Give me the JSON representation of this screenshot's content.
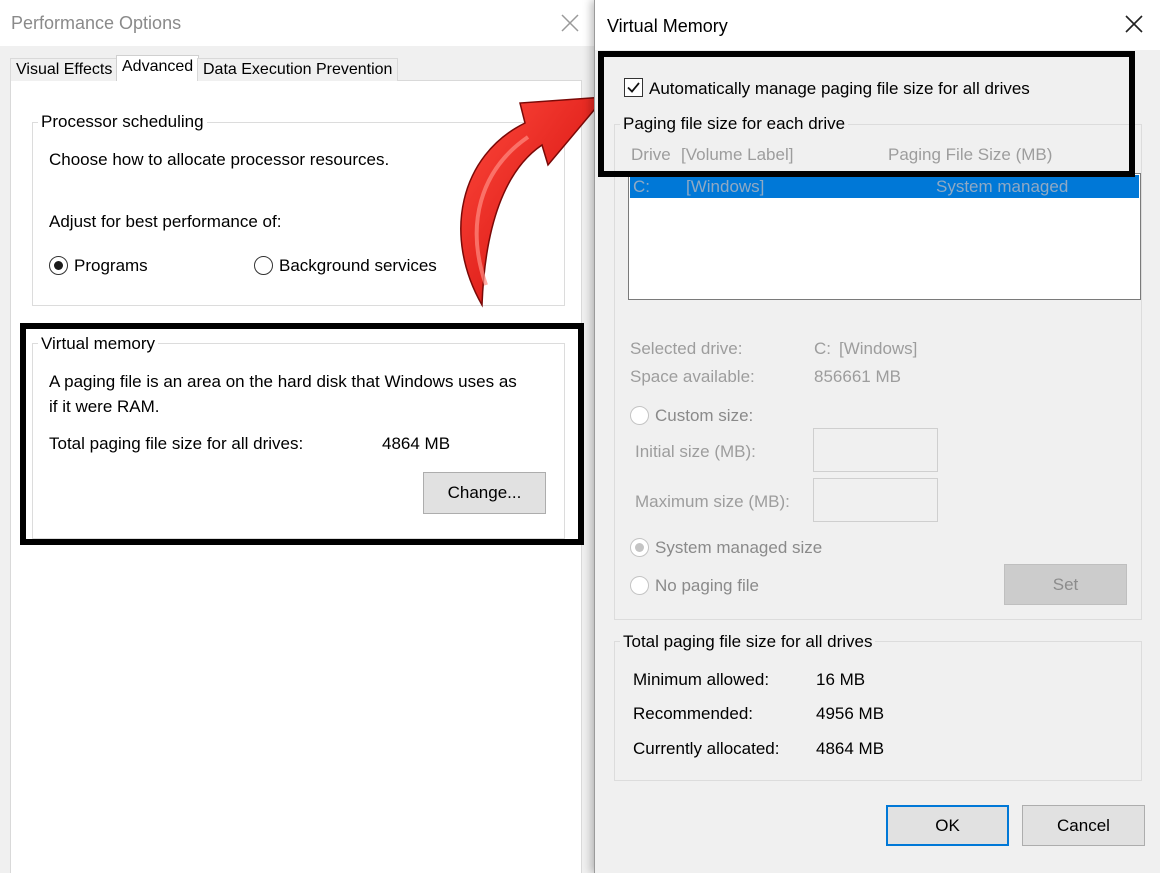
{
  "performance_options": {
    "title": "Performance Options",
    "tabs": [
      {
        "label": "Visual Effects",
        "active": false
      },
      {
        "label": "Advanced",
        "active": true
      },
      {
        "label": "Data Execution Prevention",
        "active": false
      }
    ],
    "processor_scheduling": {
      "group_label": "Processor scheduling",
      "description": "Choose how to allocate processor resources.",
      "adjust_label": "Adjust for best performance of:",
      "options": [
        {
          "label": "Programs",
          "selected": true
        },
        {
          "label": "Background services",
          "selected": false
        }
      ]
    },
    "virtual_memory": {
      "group_label": "Virtual memory",
      "description_line1": "A paging file is an area on the hard disk that Windows uses as",
      "description_line2": "if it were RAM.",
      "total_label": "Total paging file size for all drives:",
      "total_value": "4864 MB",
      "change_button": "Change..."
    }
  },
  "virtual_memory_dialog": {
    "title": "Virtual Memory",
    "auto_manage": {
      "label": "Automatically manage paging file size for all drives",
      "checked": true
    },
    "paging_group_label": "Paging file size for each drive",
    "columns": {
      "drive": "Drive",
      "volume_label": "[Volume Label]",
      "paging_size": "Paging File Size (MB)"
    },
    "drives": [
      {
        "drive": "C:",
        "label": "[Windows]",
        "size": "System managed",
        "selected": true
      }
    ],
    "selected_drive": {
      "label": "Selected drive:",
      "drive": "C:",
      "volume": "[Windows]"
    },
    "space_available": {
      "label": "Space available:",
      "value": "856661 MB"
    },
    "custom_size": {
      "label": "Custom size:",
      "selected": false
    },
    "initial_size_label": "Initial size (MB):",
    "maximum_size_label": "Maximum size (MB):",
    "system_managed": {
      "label": "System managed size",
      "selected": true
    },
    "no_paging": {
      "label": "No paging file",
      "selected": false
    },
    "set_button": "Set",
    "totals": {
      "group_label": "Total paging file size for all drives",
      "minimum": {
        "label": "Minimum allowed:",
        "value": "16 MB"
      },
      "recommended": {
        "label": "Recommended:",
        "value": "4956 MB"
      },
      "allocated": {
        "label": "Currently allocated:",
        "value": "4864 MB"
      }
    },
    "ok_button": "OK",
    "cancel_button": "Cancel"
  },
  "icons": {
    "close": "close-icon",
    "arrow": "red-curved-arrow-icon",
    "check": "checkmark-icon"
  },
  "colors": {
    "selection": "#0078d7",
    "arrow": "#e0201b",
    "highlight_box": "#000000"
  }
}
